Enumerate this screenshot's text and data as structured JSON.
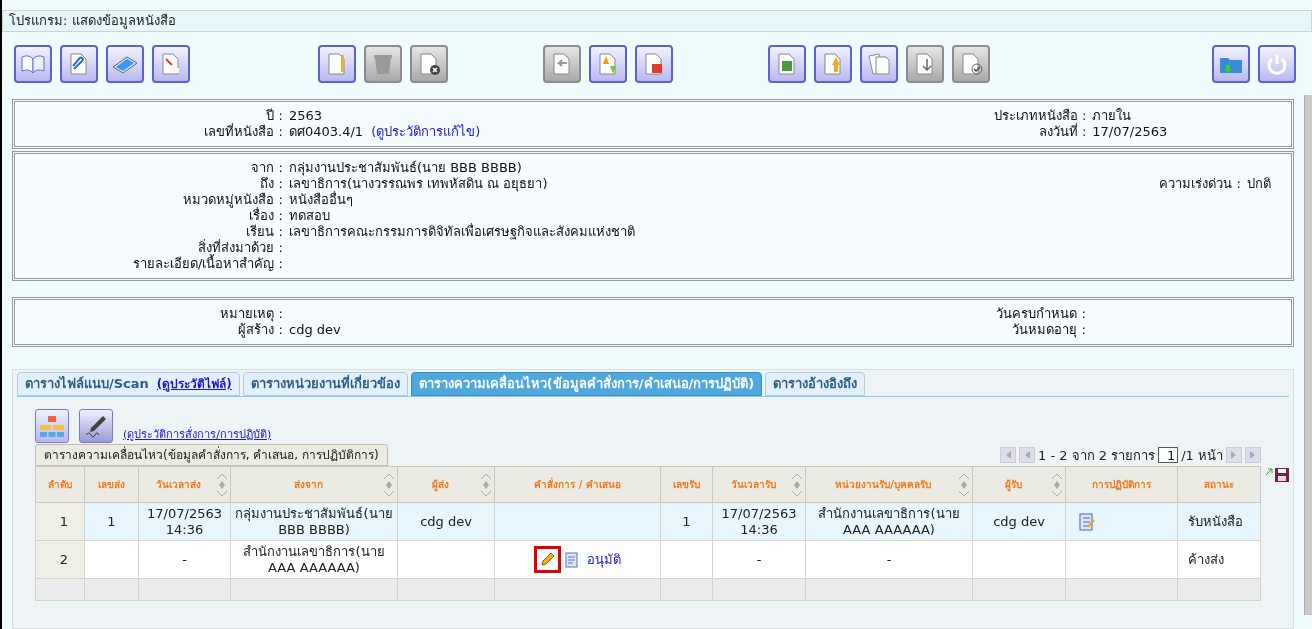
{
  "window": {
    "title": "โปรแกรม: แสดงข้อมูลหนังสือ"
  },
  "toolbar": {
    "groups": [
      [
        {
          "disabled": false
        },
        {
          "disabled": false
        },
        {
          "disabled": false
        },
        {
          "disabled": false
        }
      ],
      [
        {
          "disabled": false
        },
        {
          "disabled": true
        },
        {
          "disabled": true
        }
      ],
      [
        {
          "disabled": true
        },
        {
          "disabled": false
        },
        {
          "disabled": false
        }
      ],
      [
        {
          "disabled": false
        },
        {
          "disabled": false
        },
        {
          "disabled": false
        },
        {
          "disabled": true
        },
        {
          "disabled": true
        }
      ],
      [
        {
          "disabled": false
        },
        {
          "disabled": false
        }
      ]
    ]
  },
  "panels": [
    {
      "rows": [
        {
          "left": {
            "label": "ปี :",
            "value": "2563"
          },
          "right": {
            "label": "ประเภทหนังสือ :",
            "value": "ภายใน"
          }
        },
        {
          "left": {
            "label": "เลขที่หนังสือ :",
            "value": "ดศ0403.4/1",
            "link": "(ดูประวัติการแก้ไข)"
          },
          "right": {
            "label": "ลงวันที่ :",
            "value": "17/07/2563"
          }
        }
      ]
    },
    {
      "rows": [
        {
          "left": {
            "label": "จาก :",
            "value": "กลุ่มงานประชาสัมพันธ์(นาย BBB BBBB)"
          }
        },
        {
          "left": {
            "label": "ถึง :",
            "value": "เลขาธิการ(นางวรรณพร เทพหัสดิน ณ อยุธยา)"
          },
          "right": {
            "label": "ความเร่งด่วน :",
            "value": "ปกติ"
          }
        },
        {
          "left": {
            "label": "หมวดหมู่หนังสือ :",
            "value": "หนังสืออื่นๆ"
          }
        },
        {
          "left": {
            "label": "เรื่อง :",
            "value": "ทดสอบ"
          }
        },
        {
          "left": {
            "label": "เรียน :",
            "value": "เลขาธิการคณะกรรมการดิจิทัลเพื่อเศรษฐกิจและสังคมแห่งชาติ"
          }
        },
        {
          "left": {
            "label": "สิ่งที่ส่งมาด้วย :"
          }
        },
        {
          "left": {
            "label": "รายละเอียด/เนื้อหาสำคัญ :"
          }
        }
      ]
    },
    {
      "rows": [
        {
          "left": {
            "label": "หมายเหตุ :"
          },
          "right": {
            "label": "วันครบกำหนด :"
          }
        },
        {
          "left": {
            "label": "ผู้สร้าง :",
            "value": "cdg dev"
          },
          "right": {
            "label": "วันหมดอายุ :"
          }
        }
      ]
    }
  ],
  "tabs": [
    {
      "label": "ตารางไฟล์แนบ/Scan",
      "link": "(ดูประวัติไฟล์)",
      "selected": false
    },
    {
      "label": "ตารางหน่วยงานที่เกี่ยวข้อง",
      "selected": false
    },
    {
      "label": "ตารางความเคลื่อนไหว(ข้อมูลคำสั่งการ/คำเสนอ/การปฏิบัติ)",
      "selected": true
    },
    {
      "label": "ตารางอ้างอิงถึง",
      "selected": false
    }
  ],
  "movement": {
    "history_link": "(ดูประวัติการสั่งการ/การปฏิบัติ)",
    "caption": "ตารางความเคลื่อนไหว(ข้อมูลคำสั่งการ, คำเสนอ, การปฏิบัติการ)",
    "pager": {
      "summary": "1 - 2 จาก 2 รายการ",
      "page": "1",
      "total": "/1 หน้า"
    },
    "columns": [
      {
        "label": "ลำดับ",
        "sortable": false
      },
      {
        "label": "เลขส่ง",
        "sortable": false
      },
      {
        "label": "วันเวลาส่ง",
        "sortable": true
      },
      {
        "label": "ส่งจาก",
        "sortable": true
      },
      {
        "label": "ผู้ส่ง",
        "sortable": true
      },
      {
        "label": "คำสั่งการ / คำเสนอ",
        "sortable": false
      },
      {
        "label": "เลขรับ",
        "sortable": false
      },
      {
        "label": "วันเวลารับ",
        "sortable": true
      },
      {
        "label": "หน่วยงานรับ/บุคคลรับ",
        "sortable": true
      },
      {
        "label": "ผู้รับ",
        "sortable": true
      },
      {
        "label": "การปฏิบัติการ",
        "sortable": false
      },
      {
        "label": "สถานะ",
        "sortable": false
      }
    ],
    "rows": [
      {
        "selected": true,
        "no": "1",
        "send_no": "1",
        "send_time": "17/07/2563 14:36",
        "from": "กลุ่มงานประชาสัมพันธ์(นาย BBB BBBB)",
        "sender": "cdg dev",
        "recv_no": "1",
        "recv_time": "17/07/2563 14:36",
        "receiver_unit": "สำนักงานเลขาธิการ(นาย AAA AAAAAA)",
        "receiver": "cdg dev",
        "action_note": true,
        "status": "รับหนังสือ"
      },
      {
        "selected": false,
        "no": "2",
        "send_time": "-",
        "from": "สำนักงานเลขาธิการ(นาย AAA AAAAAA)",
        "command": {
          "highlighted": true,
          "text": "อนุมัติ"
        },
        "recv_time": "-",
        "receiver_unit": "-",
        "action_note": false,
        "status": "ค้างส่ง"
      }
    ]
  }
}
